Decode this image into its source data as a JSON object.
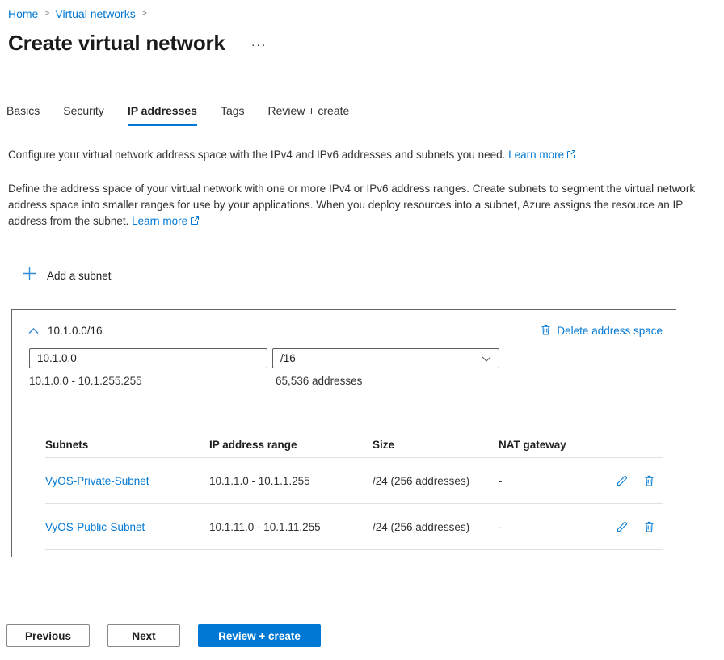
{
  "breadcrumb": {
    "items": [
      {
        "label": "Home"
      },
      {
        "label": "Virtual networks"
      }
    ]
  },
  "page": {
    "title": "Create virtual network",
    "more_options": "···"
  },
  "tabs": {
    "items": [
      {
        "label": "Basics",
        "active": false
      },
      {
        "label": "Security",
        "active": false
      },
      {
        "label": "IP addresses",
        "active": true
      },
      {
        "label": "Tags",
        "active": false
      },
      {
        "label": "Review + create",
        "active": false
      }
    ]
  },
  "intro": {
    "text": "Configure your virtual network address space with the IPv4 and IPv6 addresses and subnets you need.",
    "learn_more_label": "Learn more"
  },
  "description": {
    "text": "Define the address space of your virtual network with one or more IPv4 or IPv6 address ranges. Create subnets to segment the virtual network address space into smaller ranges for use by your applications. When you deploy resources into a subnet, Azure assigns the resource an IP address from the subnet.",
    "learn_more_label": "Learn more"
  },
  "add_subnet": {
    "label": "Add a subnet"
  },
  "address_space": {
    "cidr": "10.1.0.0/16",
    "delete_label": "Delete address space",
    "address_input_value": "10.1.0.0",
    "prefix_selected": "/16",
    "range": "10.1.0.0 - 10.1.255.255",
    "address_count": "65,536 addresses",
    "table": {
      "headers": [
        "Subnets",
        "IP address range",
        "Size",
        "NAT gateway"
      ],
      "rows": [
        {
          "name": "VyOS-Private-Subnet",
          "range": "10.1.1.0 - 10.1.1.255",
          "size": "/24 (256 addresses)",
          "nat_gateway": "-"
        },
        {
          "name": "VyOS-Public-Subnet",
          "range": "10.1.11.0 - 10.1.11.255",
          "size": "/24 (256 addresses)",
          "nat_gateway": "-"
        }
      ]
    }
  },
  "footer": {
    "previous_label": "Previous",
    "next_label": "Next",
    "review_create_label": "Review + create"
  },
  "colors": {
    "accent": "#0078d4",
    "link": "#0078d4",
    "active_tab_underline": "#0078d4",
    "primary_button_bg": "#0078d4",
    "divider": "#e1e1e1",
    "box_border": "#646464"
  }
}
